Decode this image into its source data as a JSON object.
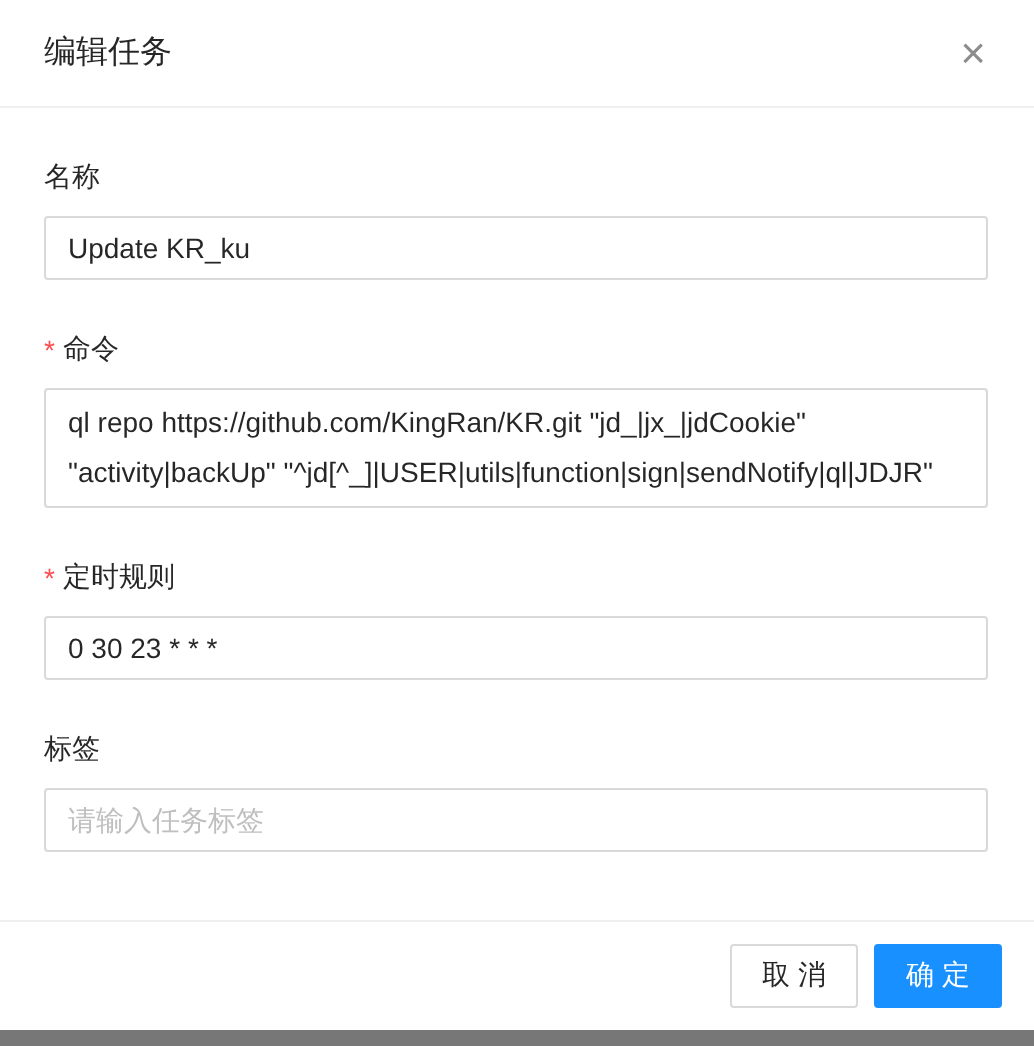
{
  "dialog": {
    "title": "编辑任务",
    "close_icon": "×"
  },
  "required_mark": "*",
  "fields": [
    {
      "label": "名称",
      "required": false,
      "kind": "input",
      "value": "Update KR_ku"
    },
    {
      "label": "命令",
      "required": true,
      "kind": "textarea",
      "value": "ql repo https://github.com/KingRan/KR.git \"jd_|jx_|jdCookie\" \"activity|backUp\" \"^jd[^_]|USER|utils|function|sign|sendNotify|ql|JDJR\""
    },
    {
      "label": "定时规则",
      "required": true,
      "kind": "input",
      "value": "0 30 23 * * *"
    },
    {
      "label": "标签",
      "required": false,
      "kind": "input",
      "placeholder": "请输入任务标签"
    }
  ],
  "buttons": [
    {
      "label": "取 消",
      "kind": "default"
    },
    {
      "label": "确 定",
      "kind": "primary"
    }
  ]
}
